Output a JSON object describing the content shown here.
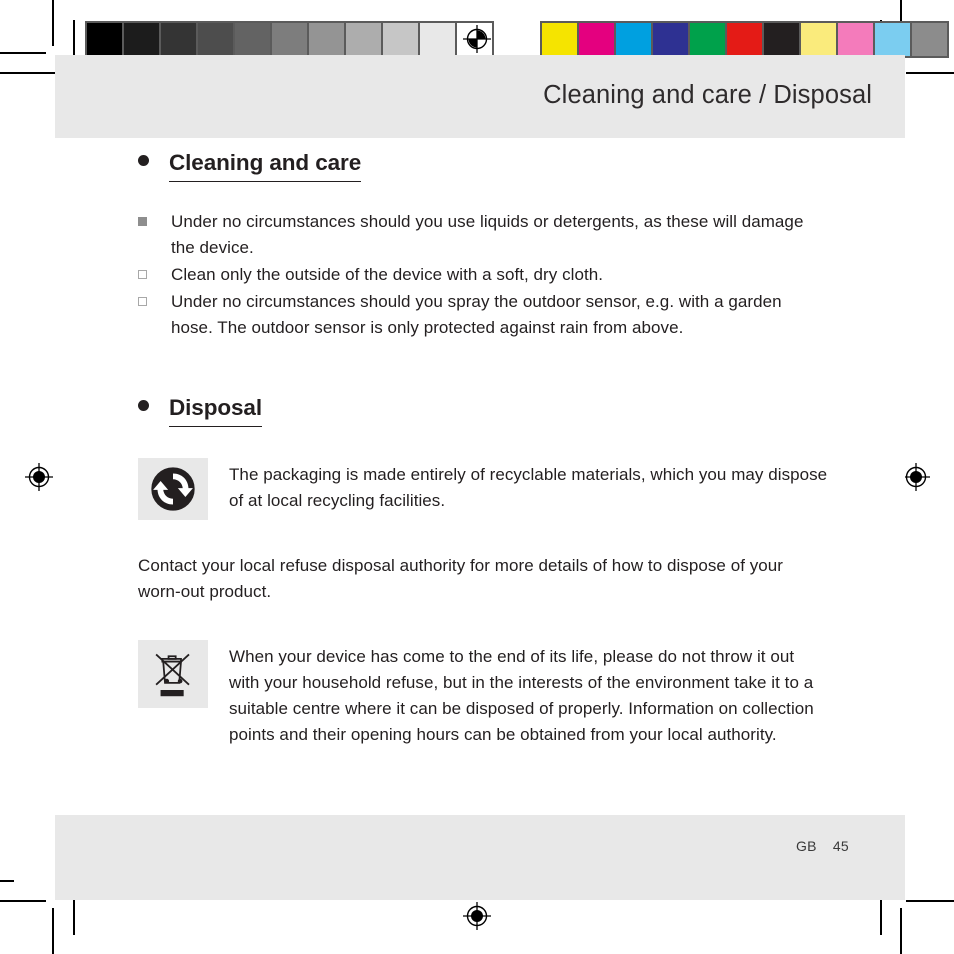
{
  "calibration": {
    "grayscale_swatches": [
      "#000000",
      "#1c1c1c",
      "#343434",
      "#4d4d4d",
      "#636363",
      "#7d7d7d",
      "#949494",
      "#adadad",
      "#c6c6c6",
      "#e8e8e8",
      "#ffffff"
    ],
    "color_swatches": [
      "#f5e400",
      "#e4007f",
      "#00a0e0",
      "#2e3192",
      "#00a14b",
      "#e41b16",
      "#231f20",
      "#faeb7c",
      "#f47bbb",
      "#7bcdf0",
      "#8c8c8c"
    ],
    "registration_mark_label": "registration-target"
  },
  "header": {
    "title": "Cleaning and care / Disposal"
  },
  "footer": {
    "locale": "GB",
    "page_number": "45"
  },
  "sections": [
    {
      "heading": "Cleaning and care",
      "bullets": [
        {
          "marker": "filled-square",
          "text": "Under no circumstances should you use liquids or detergents, as these will damage the device."
        },
        {
          "marker": "hollow-square",
          "text": "Clean only the outside of the device with a soft, dry cloth."
        },
        {
          "marker": "hollow-square",
          "text": "Under no circumstances should you spray the outdoor sensor, e.g. with a garden hose. The outdoor sensor is only protected against rain from above."
        }
      ]
    },
    {
      "heading": "Disposal",
      "recycling_block": {
        "icon": "green-dot-recycling-icon",
        "text": "The packaging is made entirely of recyclable materials, which you may dispose of at local recycling facilities."
      },
      "contact_paragraph": "Contact your local refuse disposal authority for more details of how to dispose of your worn-out product.",
      "weee_block": {
        "icon": "crossed-out-wheelie-bin-icon",
        "text": "When your device has come to the end of its life, please do not throw it out with your household refuse, but in the interests of the environment take it to a suitable centre where it can be disposed of properly. Information on collection points and their opening hours can be obtained from your local authority."
      }
    }
  ]
}
